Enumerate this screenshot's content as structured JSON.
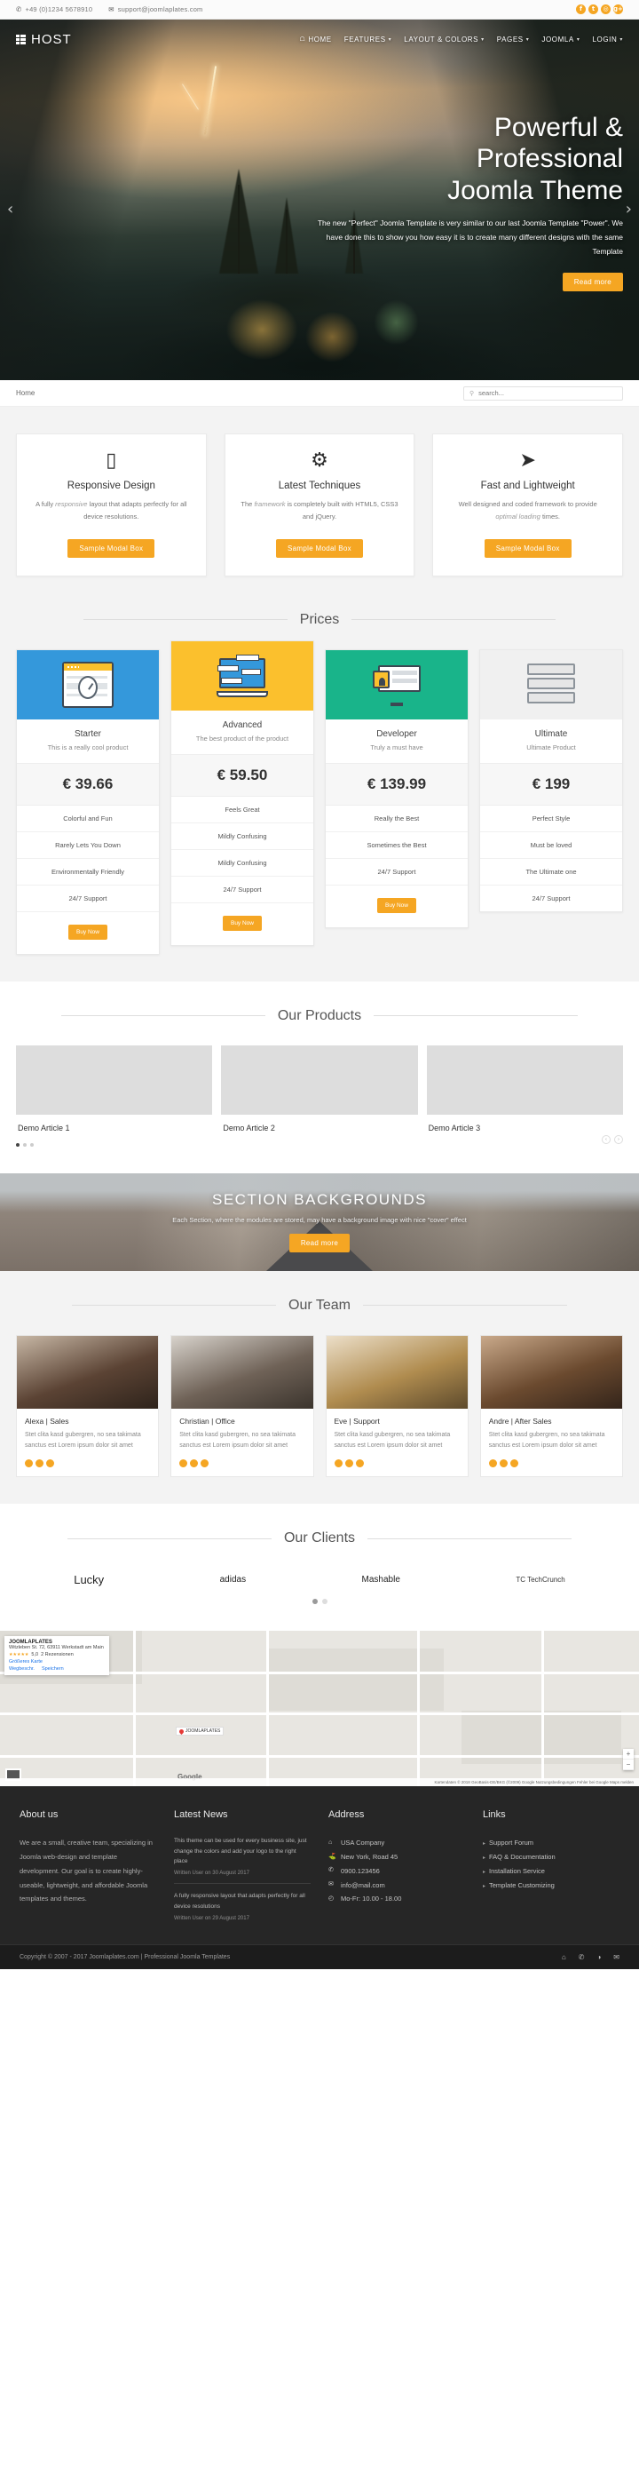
{
  "topbar": {
    "phone": "+49 (0)1234 5678910",
    "phone_icon": "phone-icon",
    "email": "support@joomlaplates.com",
    "email_icon": "envelope-icon",
    "socials": [
      {
        "name": "facebook-icon",
        "glyph": "f"
      },
      {
        "name": "twitter-icon",
        "glyph": "t"
      },
      {
        "name": "instagram-icon",
        "glyph": "◎"
      },
      {
        "name": "googleplus-icon",
        "glyph": "g+"
      }
    ]
  },
  "nav": {
    "brand": "HOST",
    "brand_icon": "grid-logo-icon",
    "items": [
      {
        "label": "HOME",
        "caret": false,
        "icon": "home-icon"
      },
      {
        "label": "FEATURES",
        "caret": true
      },
      {
        "label": "LAYOUT & COLORS",
        "caret": true
      },
      {
        "label": "PAGES",
        "caret": true
      },
      {
        "label": "JOOMLA",
        "caret": true
      },
      {
        "label": "LOGIN",
        "caret": true
      }
    ],
    "caret_glyph": "▾"
  },
  "hero": {
    "title_line1": "Powerful &",
    "title_line2": "Professional",
    "title_line3": "Joomla Theme",
    "paragraph": "The new \"Perfect\" Joomla Template is very similar to our last Joomla Template \"Power\". We have done this to show you how easy it is to create many different designs with the same Template",
    "button": "Read more",
    "prev_arrow": "‹",
    "next_arrow": "›"
  },
  "breadcrumb": {
    "text": "Home",
    "search_placeholder": "search...",
    "search_value": "",
    "search_icon": "search-icon"
  },
  "features": [
    {
      "icon": "mobile-phone-icon",
      "glyph": "▯",
      "title": "Responsive Design",
      "text_parts": [
        "A fully ",
        "responsive",
        " layout that adapts perfectly for all device resolutions."
      ],
      "button": "Sample Modal Box"
    },
    {
      "icon": "gears-icon",
      "glyph": "⚙",
      "title": "Latest Techniques",
      "text_parts": [
        "The ",
        "framework",
        " is completely built with HTML5, CSS3 and jQuery."
      ],
      "button": "Sample Modal Box"
    },
    {
      "icon": "rocket-icon",
      "glyph": "➤",
      "title": "Fast and Lightweight",
      "text_parts": [
        "Well designed and coded framework to provide ",
        "optimal loading",
        " times."
      ],
      "button": "Sample Modal Box"
    }
  ],
  "prices": {
    "title": "Prices",
    "plans": [
      {
        "name": "Starter",
        "desc": "This is a really cool product",
        "price": "€ 39.66",
        "header_color": "#3498db",
        "art": "browser-stopwatch-icon",
        "features": [
          "Colorful and Fun",
          "Rarely Lets You Down",
          "Environmentally Friendly",
          "24/7 Support"
        ],
        "button": "Buy Now"
      },
      {
        "name": "Advanced",
        "desc": "The best product of the product",
        "price": "€ 59.50",
        "header_color": "#fbc02d",
        "art": "laptop-chat-icon",
        "features": [
          "Feels Great",
          "Mildly Confusing",
          "Mildly Confusing",
          "24/7 Support"
        ],
        "button": "Buy Now"
      },
      {
        "name": "Developer",
        "desc": "Truly a must have",
        "price": "€ 139.99",
        "header_color": "#19b48a",
        "art": "monitor-lock-icon",
        "features": [
          "Really the Best",
          "Sometimes the Best",
          "24/7 Support"
        ],
        "button": "Buy Now"
      },
      {
        "name": "Ultimate",
        "desc": "Ultimate Product",
        "price": "€ 199",
        "header_color": "#f0f0f0",
        "art": "server-rack-icon",
        "features": [
          "Perfect Style",
          "Must be loved",
          "The Ultimate one",
          "24/7 Support"
        ],
        "button": ""
      }
    ]
  },
  "products": {
    "title": "Our Products",
    "items": [
      {
        "caption": "Demo Article 1",
        "image": "fashion-suit-photo"
      },
      {
        "caption": "Demo Article 2",
        "image": "jar-on-wood-photo"
      },
      {
        "caption": "Demo Article 3",
        "image": "keyboard-hand-photo"
      }
    ],
    "dots": [
      true,
      false,
      false
    ],
    "prev_arrow": "‹",
    "next_arrow": "›"
  },
  "background_section": {
    "heading": "SECTION BACKGROUNDS",
    "subtext": "Each Section, where the modules are stored, may have a background image with nice \"cover\" effect",
    "button": "Read more"
  },
  "team": {
    "title": "Our Team",
    "members": [
      {
        "name": "Alexa | Sales",
        "bio": "Stet clita kasd gubergren, no sea takimata sanctus est Lorem ipsum dolor sit amet",
        "photo": "woman-dark-hair-photo"
      },
      {
        "name": "Christian | Office",
        "bio": "Stet clita kasd gubergren, no sea takimata sanctus est Lorem ipsum dolor sit amet",
        "photo": "man-glasses-photo"
      },
      {
        "name": "Eve | Support",
        "bio": "Stet clita kasd gubergren, no sea takimata sanctus est Lorem ipsum dolor sit amet",
        "photo": "woman-blonde-photo"
      },
      {
        "name": "Andre | After Sales",
        "bio": "Stet clita kasd gubergren, no sea takimata sanctus est Lorem ipsum dolor sit amet",
        "photo": "man-curly-photo"
      }
    ],
    "social_icons": [
      "facebook-icon",
      "twitter-icon",
      "googleplus-icon"
    ]
  },
  "clients": {
    "title": "Our Clients",
    "logos": [
      {
        "name": "Lucky",
        "style": "big"
      },
      {
        "name": "adidas",
        "style": "small"
      },
      {
        "name": "Mashable",
        "style": "small"
      },
      {
        "name": "TC TechCrunch",
        "style": "tc"
      }
    ],
    "dots": [
      true,
      false
    ]
  },
  "map": {
    "card_title": "JOOMLAPLATES",
    "card_addr": "Witzleben St. 72, 63911 Werkstadt am Main",
    "card_rating": "5,0",
    "card_reviews": "2 Rezensionen",
    "card_view": "Größeres Karte",
    "btn_directions": "Wegbeschr.",
    "btn_save": "Speichern",
    "pin_label": "JOOMLAPLATES",
    "logo": "Google",
    "zoom_in": "+",
    "zoom_out": "−",
    "attribution": "Kartendaten © 2018 GeoBasis-DE/BKG (©2009)   Google   Nutzungsbedingungen   Fehler bei Google Maps melden"
  },
  "footer": {
    "about": {
      "title": "About us",
      "text": "We are a small, creative team, specializing in Joomla web-design and template development. Our goal is to create highly-useable, lightweight, and affordable Joomla templates and themes."
    },
    "news": {
      "title": "Latest News",
      "items": [
        {
          "body": "This theme can be used for every business site, just change the colors and add your logo to the right place",
          "meta": "Written User on 30 August 2017"
        },
        {
          "body": "A fully responsive layout that adapts perfectly for all device resolutions",
          "meta": "Written User on 29 August 2017"
        }
      ]
    },
    "address": {
      "title": "Address",
      "lines": [
        {
          "icon": "building-icon",
          "glyph": "⌂",
          "text": "USA Company"
        },
        {
          "icon": "map-marker-icon",
          "glyph": "⛳",
          "text": "New York, Road 45"
        },
        {
          "icon": "phone-icon",
          "glyph": "✆",
          "text": "0900.123456"
        },
        {
          "icon": "envelope-icon",
          "glyph": "✉",
          "text": "info@mail.com"
        },
        {
          "icon": "clock-icon",
          "glyph": "◴",
          "text": "Mo-Fr: 10.00 - 18.00"
        }
      ]
    },
    "links": {
      "title": "Links",
      "items": [
        "Support Forum",
        "FAQ & Documentation",
        "Installation Service",
        "Template Customizing"
      ]
    },
    "copyright": "Copyright © 2007 - 2017 Joomlaplates.com | Professional Joomla Templates",
    "copy_socials": [
      {
        "name": "home-icon",
        "glyph": "⌂"
      },
      {
        "name": "phone-icon",
        "glyph": "✆"
      },
      {
        "name": "globe-icon",
        "glyph": "◑"
      },
      {
        "name": "envelope-icon",
        "glyph": "✉"
      }
    ]
  },
  "colors": {
    "accent": "#f5a623",
    "footer_bg": "#262626",
    "copy_bg": "#1c1c1c",
    "section_gray": "#f3f3f3"
  }
}
